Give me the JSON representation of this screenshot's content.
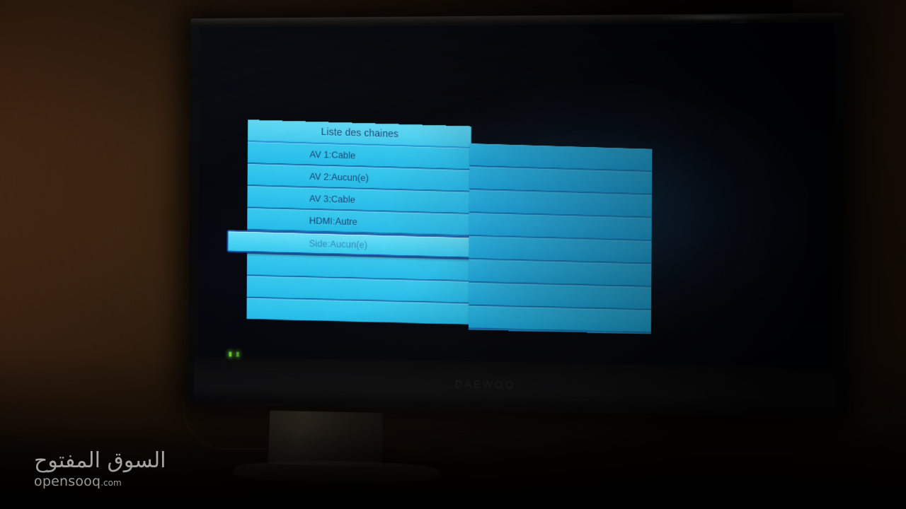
{
  "photo": {
    "subject": "flat-screen television displaying on-screen channel list menu",
    "scene_brightness": "dim room, dark brown wall"
  },
  "tv": {
    "brand_text": "DAEWOO",
    "power_led": "green",
    "bezel_color": "#0a0a0c",
    "stand_color": "#4b4740"
  },
  "osd": {
    "title": "Liste des chaines",
    "accent_color": "#2cc3ee",
    "panel_color": "#1a93da",
    "title_bar_color": "#4fd2f2",
    "text_color": "#0b3e73",
    "highlight_color": "#4fd6f5",
    "highlight_border": "#1450a8",
    "rows": [
      {
        "label": "AV 1:Cable",
        "selected": false,
        "empty": false
      },
      {
        "label": "AV 2:Aucun(e)",
        "selected": false,
        "empty": false
      },
      {
        "label": "AV 3:Cable",
        "selected": false,
        "empty": false
      },
      {
        "label": "HDMI:Autre",
        "selected": false,
        "empty": false
      },
      {
        "label": "Side:Aucun(e)",
        "selected": true,
        "empty": false
      },
      {
        "label": "",
        "selected": false,
        "empty": true
      },
      {
        "label": "",
        "selected": false,
        "empty": true
      },
      {
        "label": "",
        "selected": false,
        "empty": true
      }
    ],
    "right_panel_rows": [
      "",
      "",
      "",
      "",
      "",
      "",
      "",
      ""
    ]
  },
  "watermark": {
    "arabic": "السوق المفتوح",
    "brand": "opensooq",
    "tld": ".com"
  }
}
